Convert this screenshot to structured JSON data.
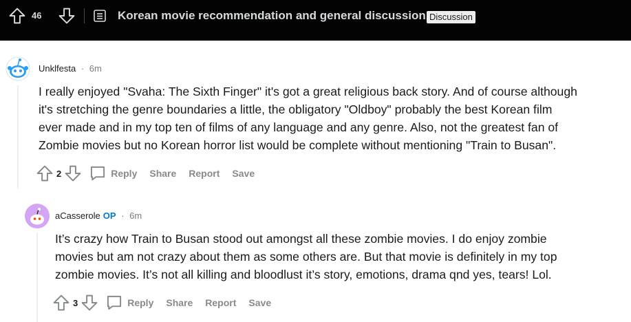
{
  "post": {
    "score": "46",
    "title": "Korean movie recommendation and general discussion.",
    "flair": "Discussion"
  },
  "comments": [
    {
      "author": "Unklfesta",
      "op_badge": "",
      "time": "6m",
      "lines": [
        "I really enjoyed \"Svaha: The Sixth Finger\" it's got a great religious back story. And of course although",
        "it's stretching the genre boundaries a little, the obligatory \"Oldboy\" probably the best Korean film",
        "ever made and in my top ten of films of any language and any genre. Also, not the greatest fan of",
        "Zombie movies but no Korean horror list would be complete without mentioning \"Train to Busan\"."
      ],
      "score": "2",
      "actions": {
        "reply": "Reply",
        "share": "Share",
        "report": "Report",
        "save": "Save"
      }
    },
    {
      "author": "aCasserole",
      "op_badge": "OP",
      "time": "6m",
      "lines": [
        "It’s crazy how Train to Busan stood out amongst all these zombie movies. I do enjoy zombie",
        "movies but am not crazy about them as some others are. But that movie is definitely in my top",
        "zombie movies. It’s not all killing and bloodlust it’s story, emotions, drama qnd yes, tears! Lol."
      ],
      "score": "3",
      "actions": {
        "reply": "Reply",
        "share": "Share",
        "report": "Report",
        "save": "Save"
      }
    }
  ],
  "colors": {
    "topbar": "#030303",
    "op": "#0079d3",
    "muted": "#878a8c"
  },
  "icons": [
    "upvote-icon",
    "downvote-icon",
    "post-icon",
    "snoo-avatar-icon",
    "comment-bubble-icon"
  ]
}
